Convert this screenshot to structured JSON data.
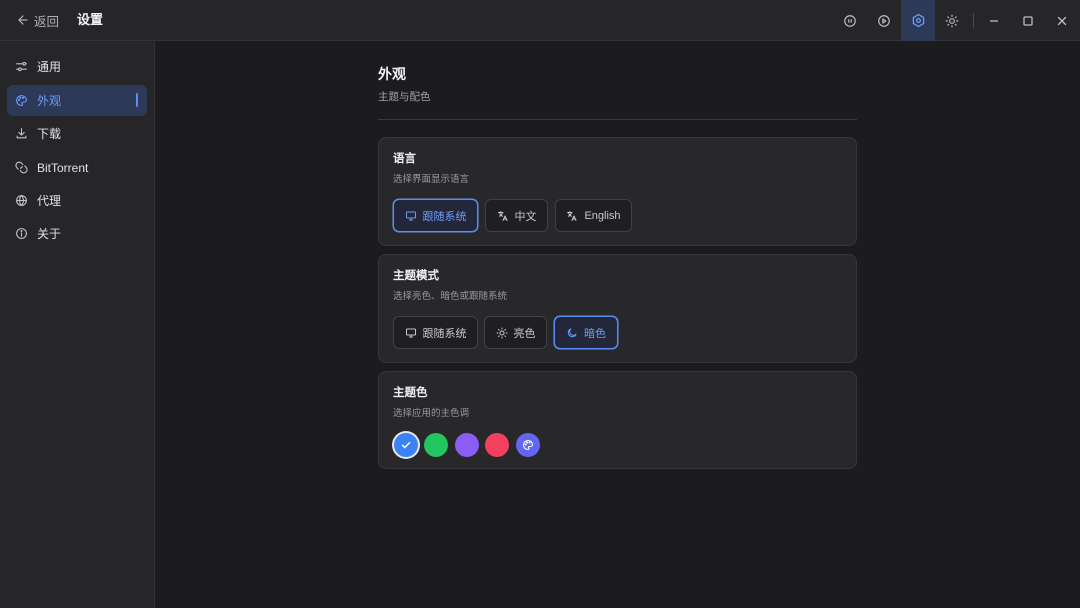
{
  "titlebar": {
    "back_label": "返回",
    "title": "设置",
    "buttons": [
      {
        "name": "pause-all-icon"
      },
      {
        "name": "play-all-icon"
      },
      {
        "name": "settings-icon",
        "active": true
      },
      {
        "name": "theme-toggle-icon"
      },
      {
        "name": "minimize-icon"
      },
      {
        "name": "maximize-icon"
      },
      {
        "name": "close-icon"
      }
    ]
  },
  "sidebar": {
    "items": [
      {
        "label": "通用",
        "icon": "sliders-icon"
      },
      {
        "label": "外观",
        "icon": "palette-icon",
        "active": true
      },
      {
        "label": "下载",
        "icon": "download-icon"
      },
      {
        "label": "BitTorrent",
        "icon": "magnet-icon"
      },
      {
        "label": "代理",
        "icon": "globe-icon"
      },
      {
        "label": "关于",
        "icon": "info-icon"
      }
    ]
  },
  "main": {
    "title": "外观",
    "subtitle": "主题与配色",
    "language": {
      "title": "语言",
      "desc": "选择界面显示语言",
      "options": [
        {
          "label": "跟随系统",
          "icon": "monitor-icon",
          "selected": true
        },
        {
          "label": "中文",
          "icon": "translate-icon"
        },
        {
          "label": "English",
          "icon": "translate-icon"
        }
      ]
    },
    "theme_mode": {
      "title": "主题模式",
      "desc": "选择亮色、暗色或跟随系统",
      "options": [
        {
          "label": "跟随系统",
          "icon": "monitor-icon"
        },
        {
          "label": "亮色",
          "icon": "sun-icon"
        },
        {
          "label": "暗色",
          "icon": "moon-icon",
          "selected": true
        }
      ]
    },
    "accent": {
      "title": "主题色",
      "desc": "选择应用的主色调",
      "colors": [
        "#3b82f6",
        "#22c55e",
        "#8b5cf6",
        "#f43f5e",
        "#6366f1"
      ],
      "selected_index": 0,
      "custom_icon": "palette-icon"
    }
  },
  "colors": {
    "accent": "#5b8ef5",
    "background": "#1c1c1e",
    "sidebar": "#262629",
    "card": "#28282b"
  }
}
